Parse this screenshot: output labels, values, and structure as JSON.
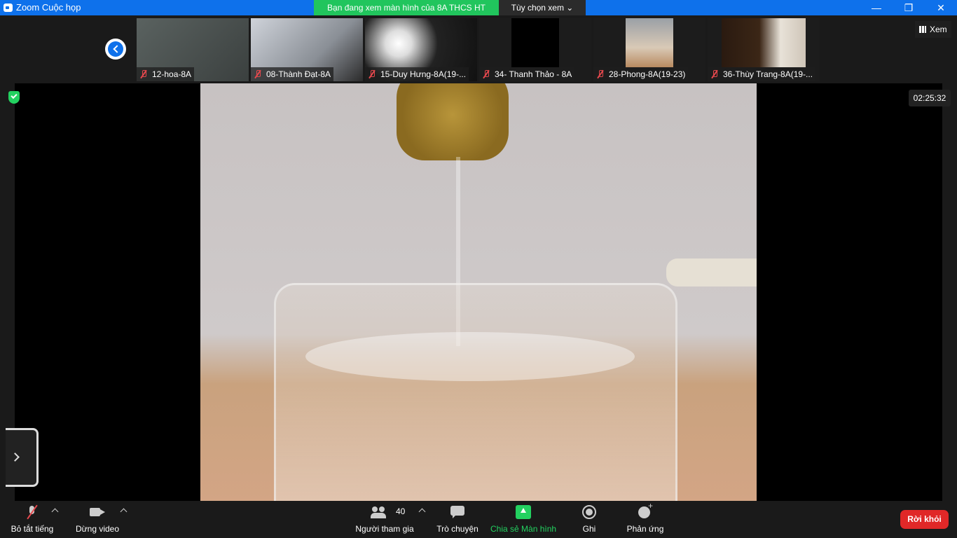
{
  "window": {
    "title": "Zoom Cuộc họp",
    "share_banner": "Bạn đang xem màn hình của 8A THCS HT",
    "view_options": "Tùy chọn xem ⌄",
    "controls": {
      "minimize": "—",
      "restore": "❐",
      "close": "✕"
    }
  },
  "thumbnails": [
    {
      "name": "12-hoa-8A"
    },
    {
      "name": "08-Thành Đạt-8A"
    },
    {
      "name": "15-Duy Hưng-8A(19-..."
    },
    {
      "name": "34- Thanh Thảo - 8A"
    },
    {
      "name": "28-Phong-8A(19-23)"
    },
    {
      "name": "36-Thùy Trang-8A(19-..."
    }
  ],
  "view_button": "Xem",
  "timer": "02:25:32",
  "toolbar": {
    "mute": "Bỏ tắt tiếng",
    "video": "Dừng video",
    "participants": "Người tham gia",
    "participants_count": "40",
    "chat": "Trò chuyện",
    "share": "Chia sẻ Màn hình",
    "record": "Ghi",
    "reactions": "Phản ứng",
    "leave": "Rời khỏi"
  },
  "colors": {
    "titlebar": "#0e71eb",
    "share_green": "#23d160",
    "leave_red": "#e02828"
  }
}
